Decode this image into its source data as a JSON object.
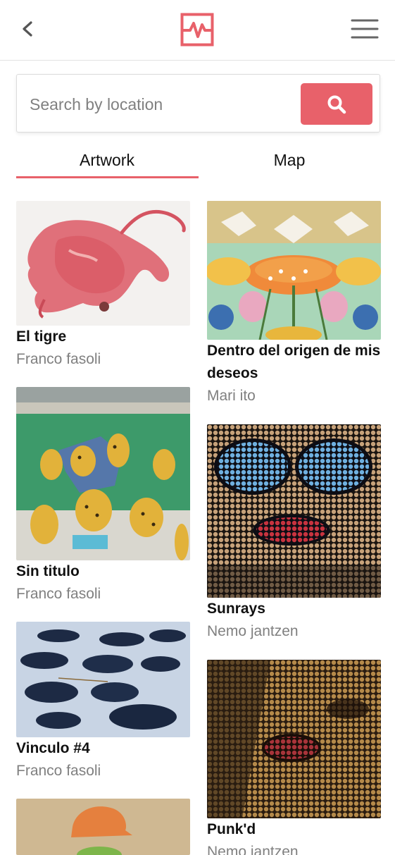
{
  "header": {
    "back_icon": "chevron-left-icon",
    "logo_icon": "pulse-logo-icon",
    "menu_icon": "hamburger-menu-icon",
    "accent_color": "#e8616a"
  },
  "search": {
    "placeholder": "Search by location",
    "value": "",
    "button_icon": "search-icon"
  },
  "tabs": [
    {
      "label": "Artwork",
      "active": true
    },
    {
      "label": "Map",
      "active": false
    }
  ],
  "artworks": {
    "left": [
      {
        "title": "El tigre",
        "artist": "Franco fasoli"
      },
      {
        "title": "Sin titulo",
        "artist": "Franco fasoli"
      },
      {
        "title": "Vinculo #4",
        "artist": "Franco fasoli"
      },
      {
        "title": "",
        "artist": ""
      }
    ],
    "right": [
      {
        "title": "Dentro del origen de mis deseos",
        "artist": "Mari ito"
      },
      {
        "title": "Sunrays",
        "artist": "Nemo jantzen"
      },
      {
        "title": "Punk'd",
        "artist": "Nemo jantzen"
      }
    ]
  }
}
